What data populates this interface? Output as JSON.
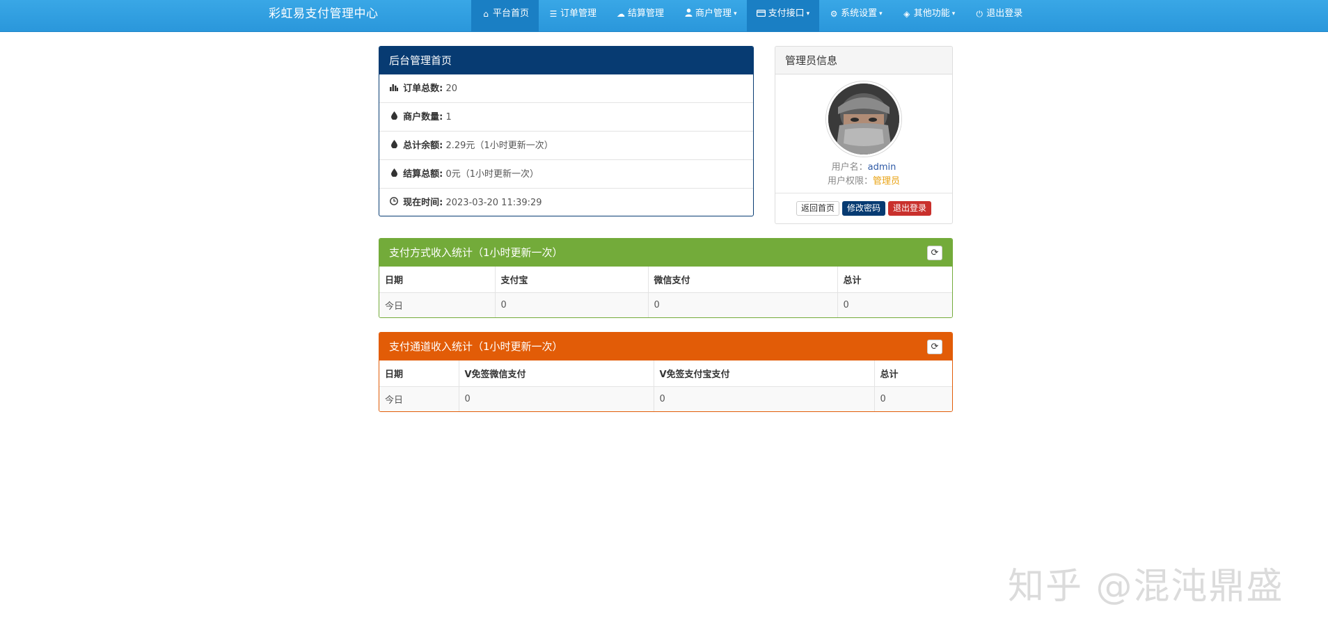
{
  "navbar": {
    "brand": "彩虹易支付管理中心",
    "items": [
      {
        "icon": "home-icon",
        "glyph": "⌂",
        "label": "平台首页",
        "dropdown": false
      },
      {
        "icon": "list-icon",
        "glyph": "☰",
        "label": "订单管理",
        "dropdown": false
      },
      {
        "icon": "cloud-icon",
        "glyph": "☁",
        "label": "结算管理",
        "dropdown": false
      },
      {
        "icon": "user-icon",
        "glyph": "👤",
        "label": "商户管理",
        "dropdown": true
      },
      {
        "icon": "credit-card-icon",
        "glyph": "▭",
        "label": "支付接口",
        "dropdown": true
      },
      {
        "icon": "gear-icon",
        "glyph": "⚙",
        "label": "系统设置",
        "dropdown": true
      },
      {
        "icon": "cube-icon",
        "glyph": "◈",
        "label": "其他功能",
        "dropdown": true
      },
      {
        "icon": "power-icon",
        "glyph": "⏻",
        "label": "退出登录",
        "dropdown": false
      }
    ]
  },
  "dashboard": {
    "title": "后台管理首页",
    "stats": [
      {
        "icon": "bar-chart-icon",
        "glyph": "▮",
        "label": "订单总数:",
        "value": "20"
      },
      {
        "icon": "drop-icon",
        "glyph": "💧",
        "label": "商户数量:",
        "value": "1"
      },
      {
        "icon": "drop-icon",
        "glyph": "💧",
        "label": "总计余额:",
        "value": "2.29元（1小时更新一次）"
      },
      {
        "icon": "drop-icon",
        "glyph": "💧",
        "label": "结算总额:",
        "value": "0元（1小时更新一次）"
      },
      {
        "icon": "clock-icon",
        "glyph": "🕘",
        "label": "现在时间:",
        "value": " 2023-03-20 11:39:29"
      }
    ]
  },
  "admin": {
    "title": "管理员信息",
    "username_label": "用户名：",
    "username": "admin",
    "role_label": "用户权限：",
    "role": "管理员",
    "buttons": {
      "home": "返回首页",
      "change_password": "修改密码",
      "logout": "退出登录"
    }
  },
  "pay_method_stats": {
    "title": "支付方式收入统计（1小时更新一次）",
    "headers": [
      "日期",
      "支付宝",
      "微信支付",
      "总计"
    ],
    "row": [
      "今日",
      "0",
      "0",
      "0"
    ]
  },
  "pay_channel_stats": {
    "title": "支付通道收入统计（1小时更新一次）",
    "headers": [
      "日期",
      "V免签微信支付",
      "V免签支付宝支付",
      "总计"
    ],
    "row": [
      "今日",
      "0",
      "0",
      "0"
    ]
  },
  "watermark": "知乎 @混沌鼎盛",
  "colors": {
    "navbar": "#2a97db",
    "navy": "#073b72",
    "green": "#73ab3a",
    "orange": "#e25c07",
    "role": "#e9a211",
    "logout_button": "#c9302c"
  }
}
